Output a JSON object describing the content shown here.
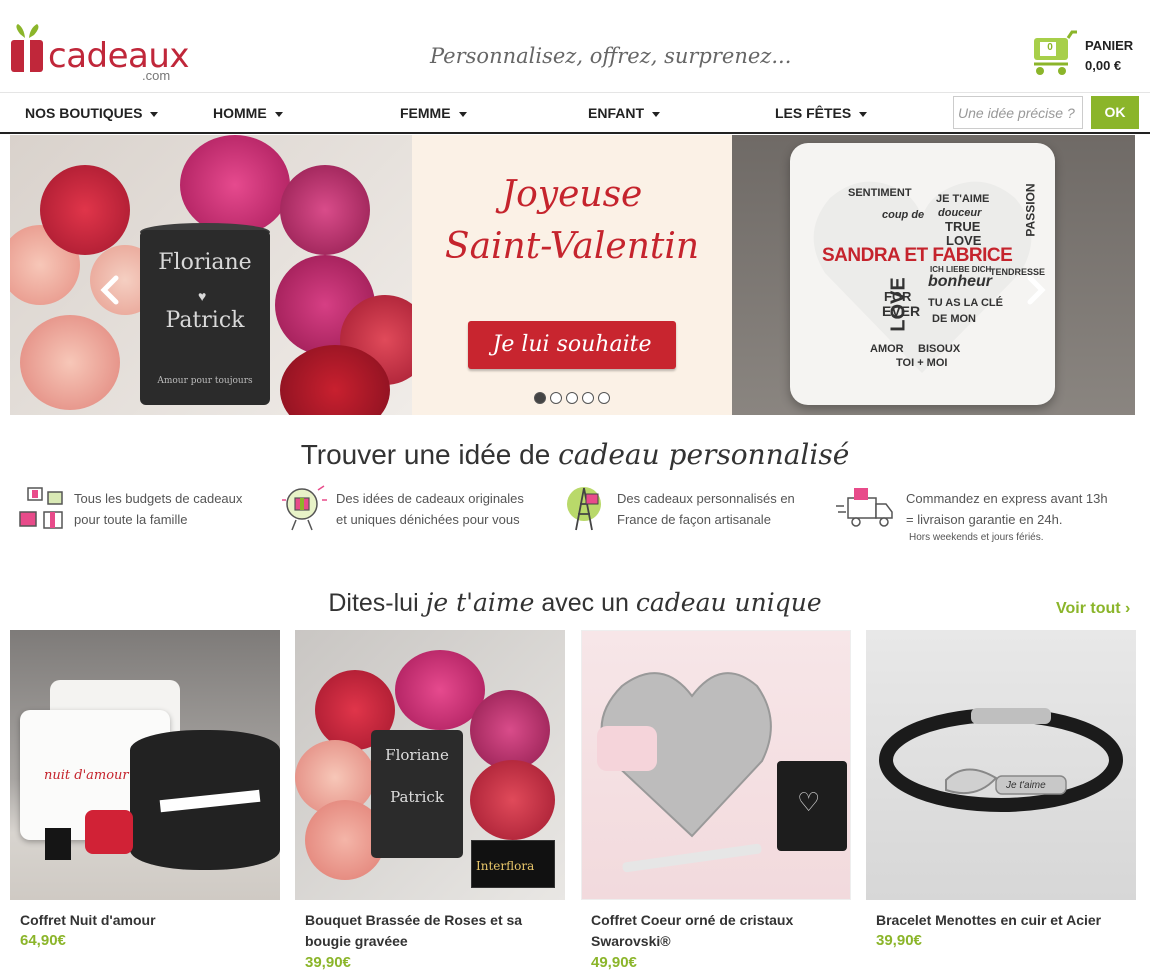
{
  "header": {
    "logo_text": "cadeaux",
    "logo_suffix": ".com",
    "tagline": "Personnalisez, offrez, surprenez...",
    "cart": {
      "count": "0",
      "label": "PANIER",
      "total": "0,00 €"
    }
  },
  "nav": {
    "items": [
      {
        "label": "NOS BOUTIQUES"
      },
      {
        "label": "HOMME"
      },
      {
        "label": "FEMME"
      },
      {
        "label": "ENFANT"
      },
      {
        "label": "LES FÊTES"
      }
    ],
    "search_placeholder": "Une idée précise ?",
    "search_button": "OK"
  },
  "banner": {
    "left": {
      "candle_line1": "Floriane",
      "candle_line2": "Patrick",
      "candle_footer": "Amour pour toujours"
    },
    "title_line1": "Joyeuse",
    "title_line2": "Saint-Valentin",
    "cta": "Je lui souhaite",
    "pillow_name": "SANDRA ET FABRICE",
    "pillow_words": [
      "SENTIMENT",
      "JE T'AIME",
      "coup de",
      "douceur",
      "TRUE",
      "LOVE",
      "bonheur",
      "TU AS LA CLÉ",
      "DE MON",
      "LOVE",
      "AMOR",
      "BISOUX",
      "TOI + MOI",
      "ICH LIEBE DICH",
      "TENDRESSE",
      "PASSION",
      "EVER",
      "FOR"
    ],
    "dots_count": 5,
    "active_dot": 0
  },
  "features_section": {
    "title_plain": "Trouver une idée de",
    "title_script": "cadeau personnalisé",
    "items": [
      {
        "icon": "gifts-icon",
        "line1": "Tous les budgets de cadeaux",
        "line2": "pour toute la famille"
      },
      {
        "icon": "lightbulb-gift-icon",
        "line1": "Des idées de cadeaux originales",
        "line2": "et uniques dénichées pour vous"
      },
      {
        "icon": "eiffel-tower-gift-icon",
        "line1": "Des cadeaux personnalisés en",
        "line2": "France de façon artisanale"
      },
      {
        "icon": "delivery-truck-icon",
        "line1": "Commandez en express avant 13h",
        "line2": "= livraison garantie en 24h.",
        "note": "Hors weekends et jours fériés."
      }
    ]
  },
  "products_section": {
    "title_plain1": "Dites-lui",
    "title_script1": "je t'aime",
    "title_plain2": "avec un",
    "title_script2": "cadeau unique",
    "see_all": "Voir tout ›",
    "items": [
      {
        "name": "Coffret Nuit d'amour",
        "price": "64,90€",
        "image_text": "nuit d'amour"
      },
      {
        "name": "Bouquet Brassée de Roses et sa bougie gravéee",
        "price": "39,90€",
        "image_text": "Interflora",
        "candle_line1": "Floriane",
        "candle_line2": "Patrick"
      },
      {
        "name": "Coffret Coeur orné de cristaux Swarovski®",
        "price": "49,90€",
        "image_text": ""
      },
      {
        "name": "Bracelet Menottes en cuir et Acier",
        "price": "39,90€",
        "image_text": "Je t'aime"
      }
    ]
  },
  "colors": {
    "brand_red": "#c0273a",
    "accent_green": "#8bb52a",
    "cta_red": "#c8252f"
  }
}
